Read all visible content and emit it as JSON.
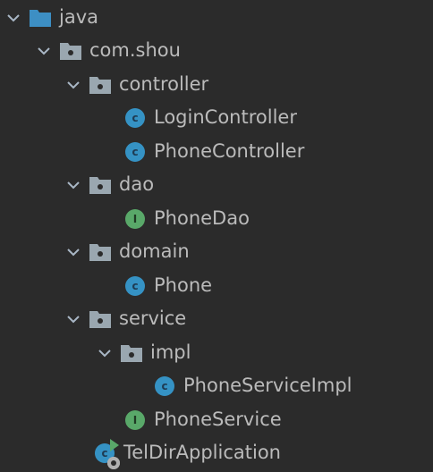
{
  "colors": {
    "background": "#2b2b2b",
    "text": "#bbbbbb",
    "chevron": "#a9b7c6",
    "source_folder": "#3d8fc4",
    "package_folder": "#9aa7b0",
    "class_badge": "#3592c4",
    "interface_badge": "#59a869",
    "run_marker": "#59a869"
  },
  "badges": {
    "class_letter": "c",
    "interface_letter": "I"
  },
  "tree": {
    "rows": [
      {
        "label": "java",
        "icon": "source-folder-icon",
        "expanded": true
      },
      {
        "label": "com.shou",
        "icon": "package-folder-icon",
        "expanded": true
      },
      {
        "label": "controller",
        "icon": "package-folder-icon",
        "expanded": true
      },
      {
        "label": "LoginController",
        "icon": "class-icon"
      },
      {
        "label": "PhoneController",
        "icon": "class-icon"
      },
      {
        "label": "dao",
        "icon": "package-folder-icon",
        "expanded": true
      },
      {
        "label": "PhoneDao",
        "icon": "interface-icon"
      },
      {
        "label": "domain",
        "icon": "package-folder-icon",
        "expanded": true
      },
      {
        "label": "Phone",
        "icon": "class-icon"
      },
      {
        "label": "service",
        "icon": "package-folder-icon",
        "expanded": true
      },
      {
        "label": "impl",
        "icon": "package-folder-icon",
        "expanded": true
      },
      {
        "label": "PhoneServiceImpl",
        "icon": "class-icon"
      },
      {
        "label": "PhoneService",
        "icon": "interface-icon"
      },
      {
        "label": "TelDirApplication",
        "icon": "spring-boot-application-icon"
      }
    ]
  }
}
